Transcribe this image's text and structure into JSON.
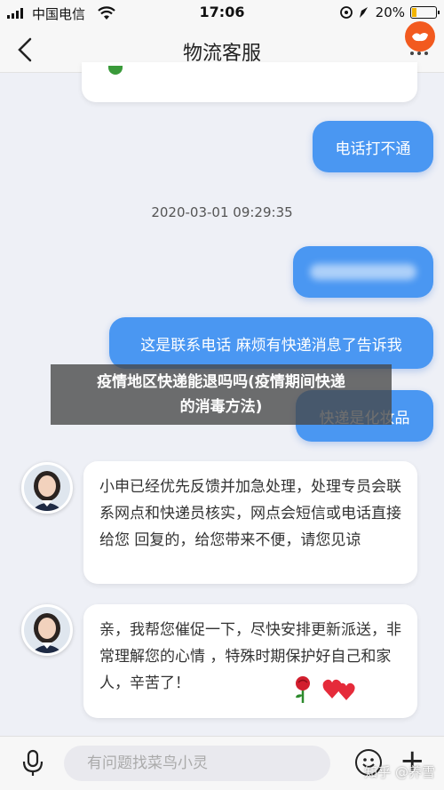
{
  "status_bar": {
    "carrier": "中国电信",
    "time": "17:06",
    "battery_percent": "20%"
  },
  "nav": {
    "title": "物流客服"
  },
  "chat": {
    "user_message_1": "电话打不通",
    "timestamp": "2020-03-01 09:29:35",
    "user_message_3": "这是联系电话 麻烦有快递消息了告诉我",
    "user_message_4": "快递是化妆品",
    "agent_message_1": "小申已经优先反馈并加急处理，处理专员会联系网点和快递员核实，网点会短信或电话直接给您 回复的，给您带来不便，请您见谅",
    "agent_message_2": "亲，我帮您催促一下，尽快安排更新派送，非常理解您的心情 ，特殊时期保护好自己和家人，辛苦了！"
  },
  "overlay": {
    "line1": "疫情地区快递能退吗吗(疫情期间快递",
    "line2": "的消毒方法)"
  },
  "input": {
    "placeholder": "有问题找菜鸟小灵"
  },
  "watermark": "知乎 @养雪",
  "colors": {
    "user_bubble": "#4a97f2",
    "accent": "#f25a1f"
  },
  "icons": [
    "signal-icon",
    "wifi-icon",
    "location-icon",
    "battery-icon",
    "back-icon",
    "cainiao-bird-icon",
    "more-icon",
    "microphone-icon",
    "emoji-icon",
    "plus-icon",
    "rose-icon",
    "hearts-icon"
  ]
}
